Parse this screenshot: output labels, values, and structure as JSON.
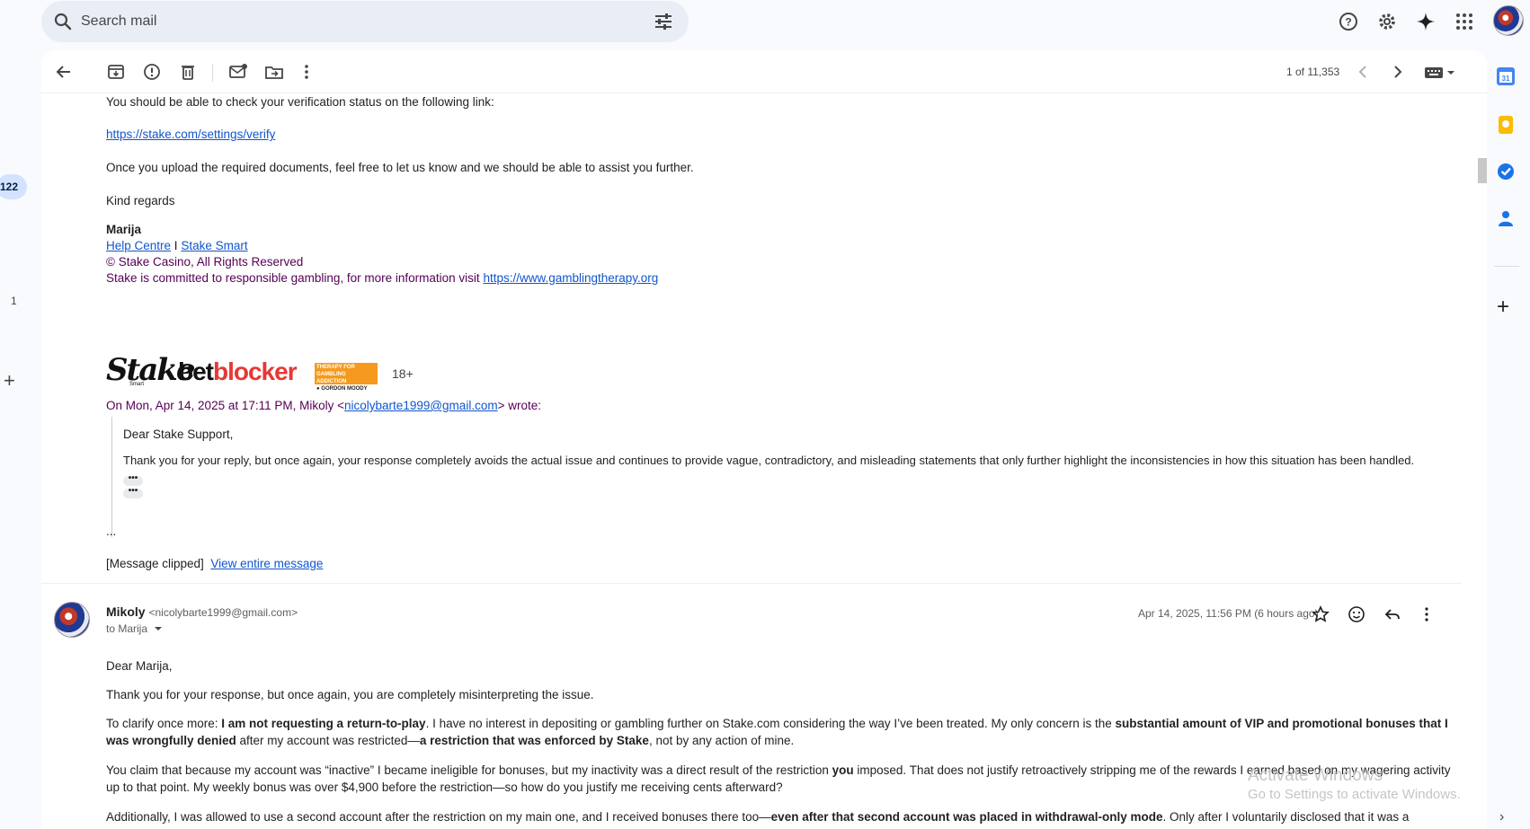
{
  "search": {
    "placeholder": "Search mail"
  },
  "leftrail": {
    "badge": "122",
    "count": "1"
  },
  "toolbar": {
    "count": "1 of 11,353"
  },
  "body": {
    "line1": "You should be able to check your verification status on the following link:",
    "verify_link": "https://stake.com/settings/verify",
    "line2": "Once you upload the required documents, feel free to let us know and we should be able to assist you further.",
    "regards": "Kind regards",
    "sig_name": "Marija",
    "help_centre": "Help Centre",
    "sep": " I ",
    "stake_smart": "Stake Smart",
    "copyright": "© Stake Casino, All Rights Reserved",
    "committed": "Stake is committed to responsible gambling, for more information visit ",
    "gt_link": "https://www.gamblingtherapy.org",
    "logo_stake": "Stake",
    "logo_smart": "Smart",
    "logo_bet": "bet",
    "logo_blocker": "blocker",
    "logo_gm1": "THERAPY FOR",
    "logo_gm2": "GAMBLING ADDICTION",
    "logo_gm3": "● GORDON MOODY",
    "logo_18": "18+",
    "on_prefix": "On Mon, Apr 14, 2025 at 17:11 PM, Mikoly <",
    "on_email": "nicolybarte1999@gmail.com",
    "on_suffix": "> wrote:",
    "quote_greet": "Dear Stake Support,",
    "quote_body": "Thank you for your reply, but once again, your response completely avoids the actual issue and continues to provide vague, contradictory, and misleading statements that only further highlight the inconsistencies in how this situation has been handled.",
    "dots": "•••",
    "ellipsis": "...",
    "clipped": "[Message clipped]",
    "view_entire": "View entire message"
  },
  "message2": {
    "sender": "Mikoly",
    "address": "<nicolybarte1999@gmail.com>",
    "to": "to Marija",
    "date": "Apr 14, 2025, 11:56 PM (6 hours ago)",
    "greet": "Dear Marija,",
    "p1": "Thank you for your response, but once again, you are completely misinterpreting the issue.",
    "p2a": "To clarify once more: ",
    "p2b": "I am not requesting a return-to-play",
    "p2c": ". I have no interest in depositing or gambling further on Stake.com considering the way I’ve been treated. My only concern is the ",
    "p2d": "substantial amount of VIP and promotional bonuses that I was wrongfully denied",
    "p2e": " after my account was restricted—",
    "p2f": "a restriction that was enforced by Stake",
    "p2g": ", not by any action of mine.",
    "p3a": "You claim that because my account was “inactive” I became ineligible for bonuses, but my inactivity was a direct result of the restriction ",
    "p3b": "you",
    "p3c": " imposed. That does not justify retroactively stripping me of the rewards I earned based on my wagering activity up to that point. My weekly bonus was over $4,900 before the restriction—so how do you justify me receiving cents afterward?",
    "p4a": "Additionally, I was allowed to use a second account after the restriction on my main one, and I received bonuses there too—",
    "p4b": "even after that second account was placed in withdrawal-only mode",
    "p4c": ". Only after I voluntarily disclosed that it was a secondary"
  },
  "watermark": {
    "line1": "Activate Windows",
    "line2": "Go to Settings to activate Windows."
  },
  "colors": {
    "link": "#1155cc",
    "signature_purple": "#550055",
    "badge_bg": "#d3e3fd"
  }
}
